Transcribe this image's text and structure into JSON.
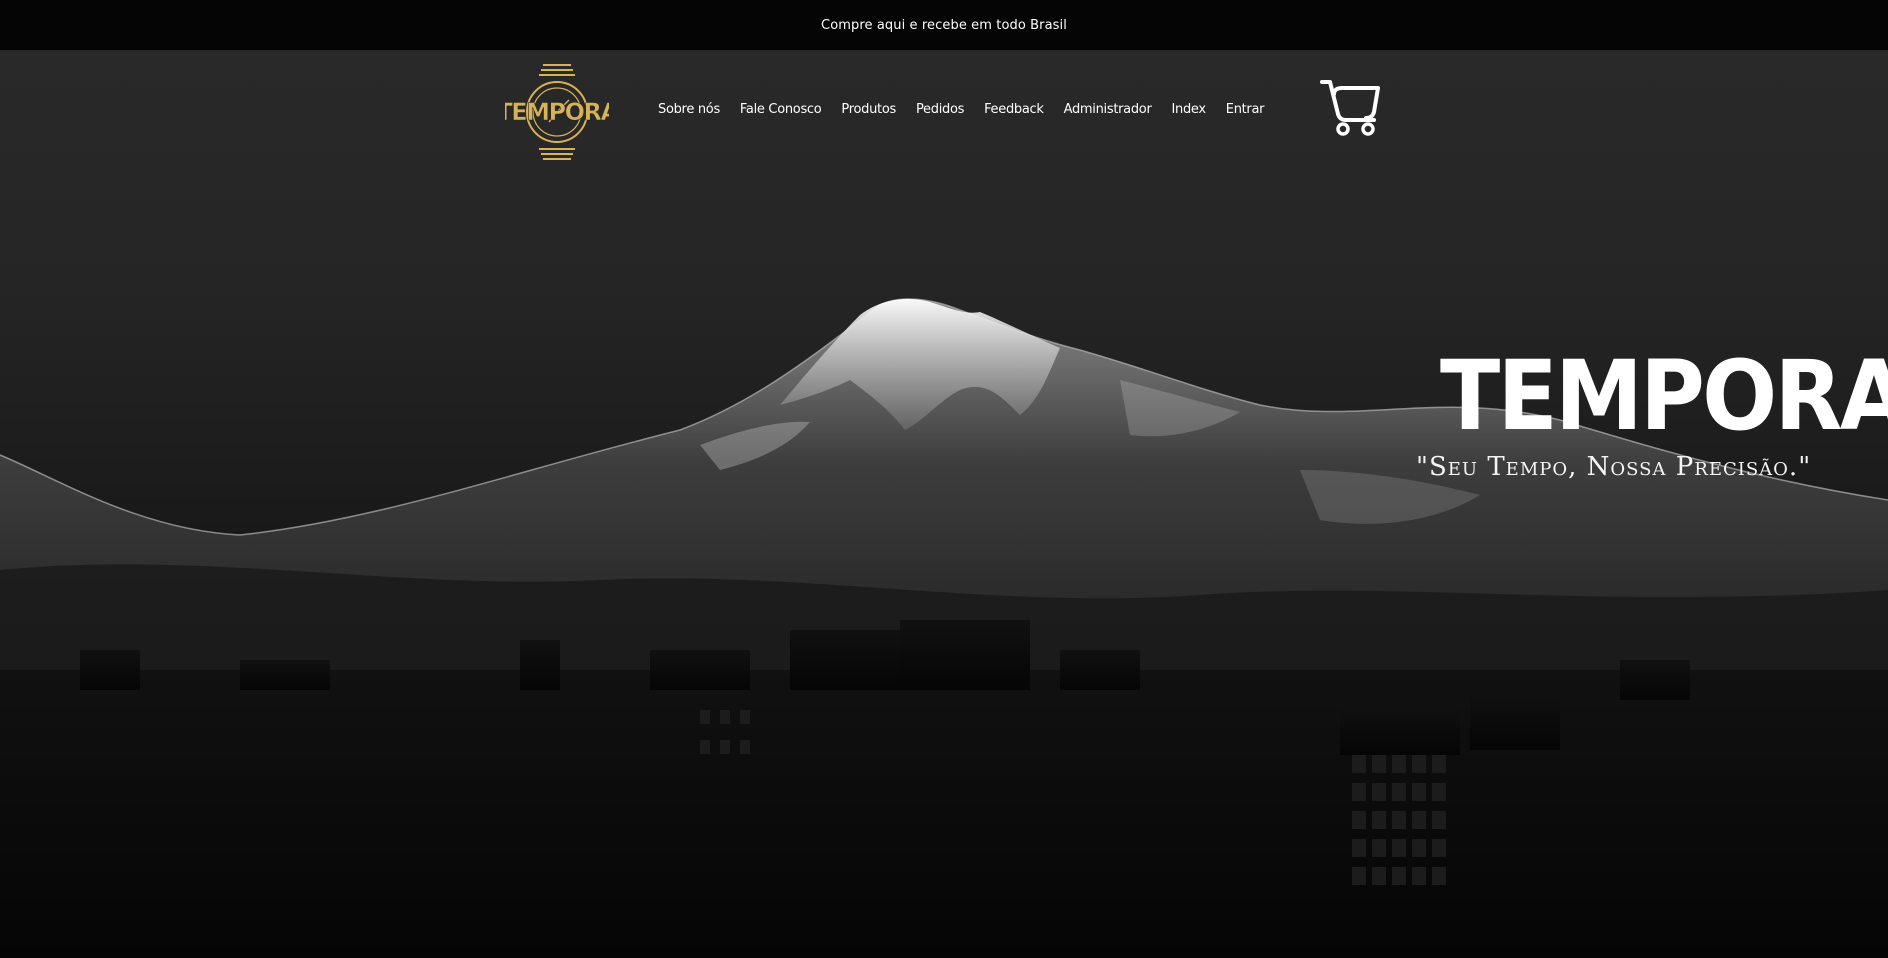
{
  "promo": {
    "text": "Compre aqui e recebe em todo Brasil"
  },
  "header": {
    "logo_text": "TEMPORA",
    "nav": [
      {
        "label": "Sobre nós"
      },
      {
        "label": "Fale Conosco"
      },
      {
        "label": "Produtos"
      },
      {
        "label": "Pedidos"
      },
      {
        "label": "Feedback"
      },
      {
        "label": "Administrador"
      },
      {
        "label": "Index"
      },
      {
        "label": "Entrar"
      }
    ],
    "cart_icon": "shopping-cart-icon"
  },
  "hero": {
    "title": "TEMPORA",
    "tagline": "\"Seu Tempo, Nossa Precisão.\""
  },
  "colors": {
    "promo_bg": "#050505",
    "logo_gold": "#d8b257",
    "text": "#ffffff",
    "bg_top": "#2a2a2a",
    "bg_bottom": "#0a0a0a"
  }
}
